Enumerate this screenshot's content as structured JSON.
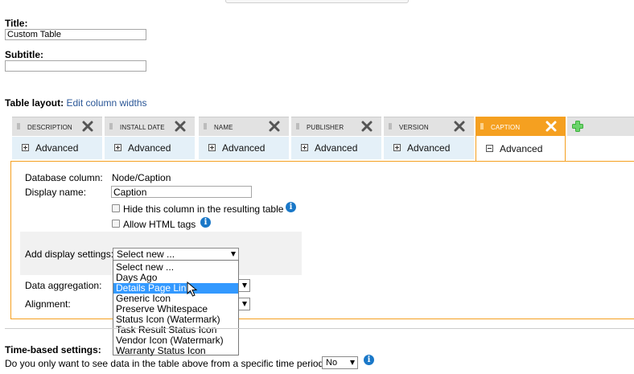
{
  "title_label": "Title:",
  "title_value": "Custom Table",
  "subtitle_label": "Subtitle:",
  "subtitle_value": "",
  "table_layout": {
    "label": "Table layout:",
    "edit_link": "Edit column widths"
  },
  "columns": [
    {
      "name": "DESCRIPTION",
      "advanced": "Advanced"
    },
    {
      "name": "INSTALL DATE",
      "advanced": "Advanced"
    },
    {
      "name": "NAME",
      "advanced": "Advanced"
    },
    {
      "name": "PUBLISHER",
      "advanced": "Advanced"
    },
    {
      "name": "VERSION",
      "advanced": "Advanced"
    },
    {
      "name": "CAPTION",
      "advanced": "Advanced"
    }
  ],
  "panel": {
    "db_column_label": "Database column:",
    "db_column_value": "Node/Caption",
    "display_name_label": "Display name:",
    "display_name_value": "Caption",
    "hide_label": "Hide this column in the resulting table",
    "allow_html_label": "Allow HTML tags",
    "add_display_label": "Add display settings:",
    "add_display_selected": "Select new ...",
    "aggregation_label": "Data aggregation:",
    "alignment_label": "Alignment:"
  },
  "dropdown_options": [
    "Select new ...",
    "Days Ago",
    "Details Page Link",
    "Generic Icon",
    "Preserve Whitespace",
    "Status Icon (Watermark)",
    "Task Result Status Icon",
    "Vendor Icon (Watermark)",
    "Warranty Status Icon"
  ],
  "time_based": {
    "label": "Time-based settings:",
    "question": "Do you only want to see data in the table above from a specific time period?",
    "value": "No"
  },
  "colors": {
    "accent": "#f5a020",
    "highlight": "#3399ff",
    "info": "#1a78c8",
    "link": "#2b5797"
  }
}
